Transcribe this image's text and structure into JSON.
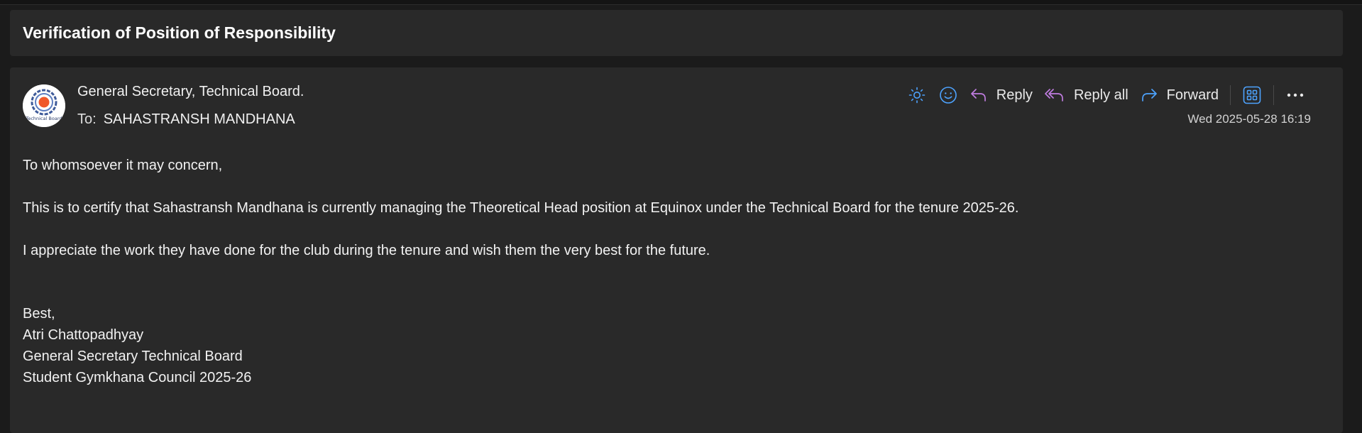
{
  "subject": "Verification of Position of Responsibility",
  "message": {
    "avatar_text": "Technical Board",
    "sender": "General Secretary, Technical Board.",
    "to_label": "To:",
    "to": "SAHASTRANSH MANDHANA",
    "date": "Wed 2025-05-28 16:19",
    "actions": {
      "brightness_icon": "sun-icon",
      "emoji_icon": "smiley-icon",
      "reply": "Reply",
      "reply_all": "Reply all",
      "forward": "Forward",
      "apps_icon": "apps-grid-icon",
      "more_icon": "more-ellipsis-icon"
    },
    "body": {
      "greeting": "To whomsoever it may concern,",
      "certify": "This is to certify that Sahastransh Mandhana is currently managing the Theoretical Head position at Equinox under the Technical Board for the tenure 2025-26.",
      "appreciate": "I appreciate the work they have done for the club during the tenure and wish them the very best for the future.",
      "signature": [
        "Best,",
        "Atri Chattopadhyay",
        "General Secretary Technical Board",
        "Student Gymkhana Council 2025-26"
      ]
    }
  },
  "colors": {
    "accent_blue": "#4da3ff",
    "reply_purple": "#c07ce0",
    "card_bg": "#292929",
    "page_bg": "#1b1b1b"
  }
}
